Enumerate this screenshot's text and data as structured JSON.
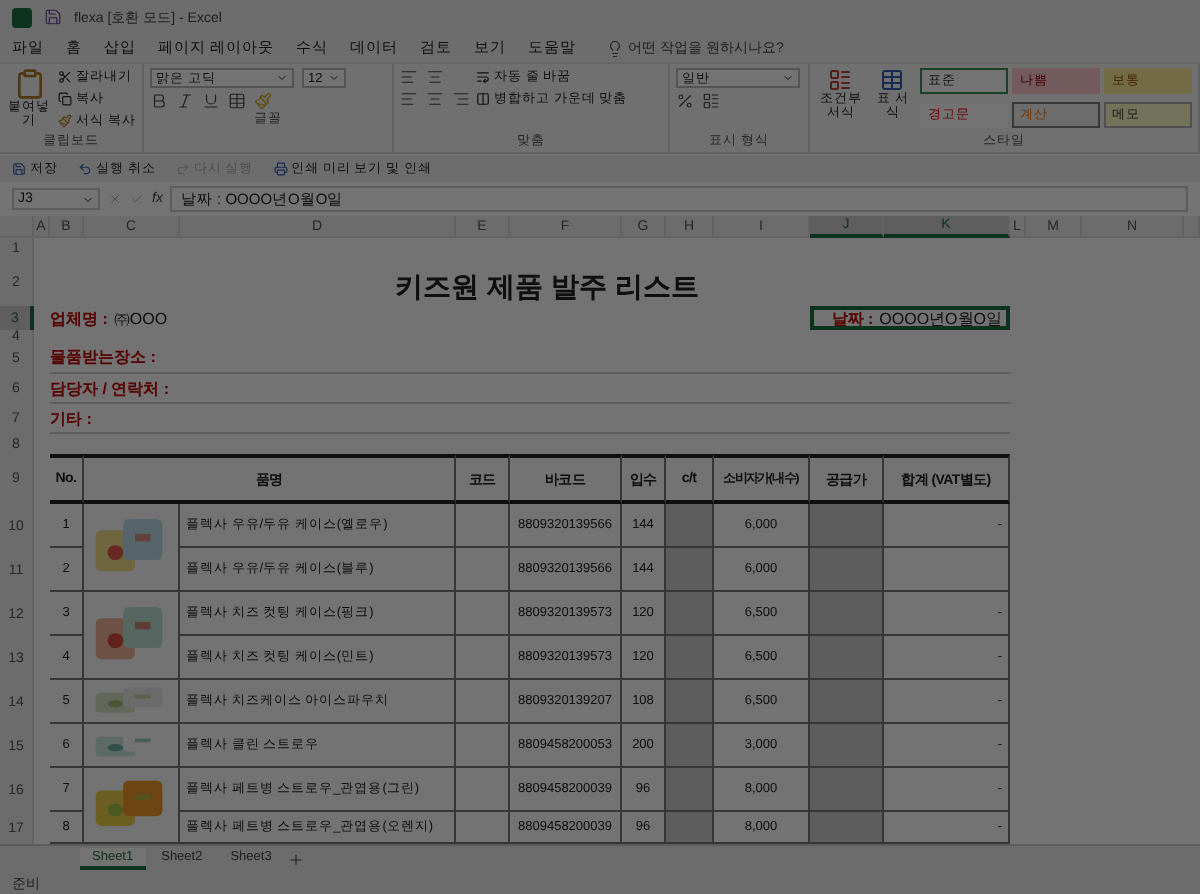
{
  "window": {
    "title": "flexa [호환 모드] - Excel"
  },
  "menu": {
    "tabs": [
      "파일",
      "홈",
      "삽입",
      "페이지 레이아웃",
      "수식",
      "데이터",
      "검토",
      "보기",
      "도움말"
    ],
    "search": {
      "placeholder": "어떤 작업을 원하시나요?"
    }
  },
  "ribbon": {
    "clipboard": {
      "paste": "붙여넣기",
      "cut": "잘라내기",
      "copy": "복사",
      "format_painter": "서식 복사",
      "label": "클립보드"
    },
    "font": {
      "name": "맑은 고딕",
      "size": "12",
      "label": "글꼴"
    },
    "alignment": {
      "wrap": "자동 줄 바꿈",
      "merge": "병합하고 가운데 맞춤",
      "label": "맞춤"
    },
    "number": {
      "format": "일반",
      "label": "표시 형식"
    },
    "styles": {
      "conditional": "조건부 서식",
      "table": "표 서식",
      "label": "스타일",
      "cells": [
        {
          "label": "표준",
          "kind": "normal"
        },
        {
          "label": "나쁨",
          "kind": "bad"
        },
        {
          "label": "보통",
          "kind": "neutral"
        },
        {
          "label": "경고문",
          "kind": "warning"
        },
        {
          "label": "계산",
          "kind": "calc"
        },
        {
          "label": "메모",
          "kind": "note"
        }
      ]
    }
  },
  "quick_access": [
    {
      "label": "저장",
      "disabled": false
    },
    {
      "label": "실행 취소",
      "disabled": false
    },
    {
      "label": "다시 실행",
      "disabled": true
    },
    {
      "label": "인쇄 미리 보기 및 인쇄",
      "disabled": false
    }
  ],
  "formula_bar": {
    "name_box": "J3",
    "fx_label": "fx",
    "formula": "날짜 : OOOO년O월O일"
  },
  "sheet": {
    "columns": [
      {
        "label": "A",
        "selected": false
      },
      {
        "label": "B",
        "selected": false
      },
      {
        "label": "C",
        "selected": false
      },
      {
        "label": "D",
        "selected": false
      },
      {
        "label": "E",
        "selected": false
      },
      {
        "label": "F",
        "selected": false
      },
      {
        "label": "G",
        "selected": false
      },
      {
        "label": "H",
        "selected": false
      },
      {
        "label": "I",
        "selected": false
      },
      {
        "label": "J",
        "selected": true
      },
      {
        "label": "K",
        "selected": true
      },
      {
        "label": "L",
        "selected": false
      },
      {
        "label": "M",
        "selected": false
      },
      {
        "label": "N",
        "selected": false
      }
    ],
    "rows": [
      {
        "label": "1",
        "selected": false
      },
      {
        "label": "2",
        "selected": false
      },
      {
        "label": "3",
        "selected": true
      },
      {
        "label": "4",
        "selected": false
      },
      {
        "label": "5",
        "selected": false
      },
      {
        "label": "6",
        "selected": false
      },
      {
        "label": "7",
        "selected": false
      },
      {
        "label": "8",
        "selected": false
      },
      {
        "label": "9",
        "selected": false
      },
      {
        "label": "10",
        "selected": false
      },
      {
        "label": "11",
        "selected": false
      },
      {
        "label": "12",
        "selected": false
      },
      {
        "label": "13",
        "selected": false
      },
      {
        "label": "14",
        "selected": false
      },
      {
        "label": "15",
        "selected": false
      },
      {
        "label": "16",
        "selected": false
      },
      {
        "label": "17",
        "selected": false
      }
    ],
    "title": "키즈원 제품 발주 리스트",
    "company": {
      "label": "업체명 :",
      "value": "㈜OOO"
    },
    "date": {
      "label": "날짜 :",
      "value": "OOOO년O월O일"
    },
    "info_lines": [
      "물품받는장소 :",
      "담당자 / 연락처 :",
      "기타 :"
    ],
    "table": {
      "columns": [
        "No.",
        "품명",
        "코드",
        "바코드",
        "입수",
        "c/t",
        "소비자가(내수)",
        "공급가",
        "합계 (VAT별도)"
      ],
      "groups": [
        {
          "kind": "picture",
          "items": [
            {
              "no": "1",
              "name": "플렉사 우유/두유 케이스(옐로우)",
              "barcode": "8809320139566",
              "qty": "144",
              "price": "6,000",
              "total": "-"
            },
            {
              "no": "2",
              "name": "플렉사 우유/두유 케이스(블루)",
              "barcode": "8809320139566",
              "qty": "144",
              "price": "6,000"
            }
          ]
        },
        {
          "kind": "picture",
          "items": [
            {
              "no": "3",
              "name": "플렉사 치즈 컷팅 케이스(핑크)",
              "barcode": "8809320139573",
              "qty": "120",
              "price": "6,500",
              "total": "-"
            },
            {
              "no": "4",
              "name": "플렉사 치즈 컷팅 케이스(민트)",
              "barcode": "8809320139573",
              "qty": "120",
              "price": "6,500",
              "total": "-"
            }
          ]
        },
        {
          "kind": "picture",
          "items": [
            {
              "no": "5",
              "name": "플렉사 치즈케이스 아이스파우치",
              "barcode": "8809320139207",
              "qty": "108",
              "price": "6,500",
              "total": "-"
            }
          ]
        },
        {
          "kind": "picture",
          "items": [
            {
              "no": "6",
              "name": "플렉사 클린 스트로우",
              "barcode": "8809458200053",
              "qty": "200",
              "price": "3,000",
              "total": "-"
            }
          ]
        },
        {
          "kind": "picture",
          "items": [
            {
              "no": "7",
              "name": "플렉사 페트병 스트로우_관엽용(그린)",
              "barcode": "8809458200039",
              "qty": "96",
              "price": "8,000",
              "total": "-"
            },
            {
              "no": "8",
              "name": "플렉사 페트병 스트로우_관엽용(오렌지)",
              "barcode": "8809458200039",
              "qty": "96",
              "price": "8,000",
              "total": "-"
            }
          ]
        }
      ]
    }
  },
  "sheet_tabs": [
    {
      "label": "Sheet1",
      "selected": true
    },
    {
      "label": "Sheet2",
      "selected": false
    },
    {
      "label": "Sheet3",
      "selected": false
    }
  ],
  "status": "준비"
}
